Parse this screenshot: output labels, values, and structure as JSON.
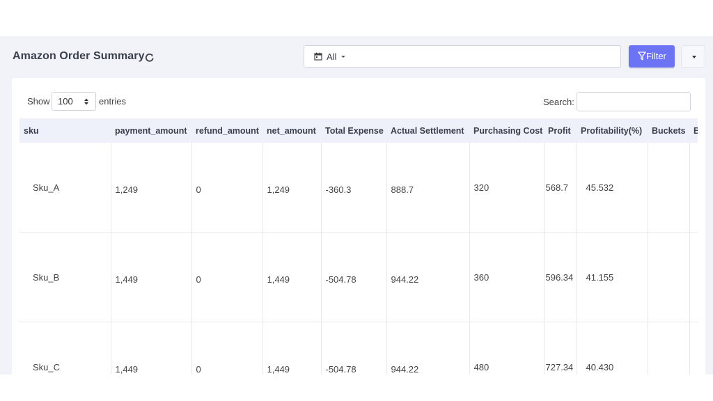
{
  "header": {
    "title": "Amazon Order Summary",
    "date_filter": "All",
    "filter_button": "Filter"
  },
  "controls": {
    "show_label": "Show",
    "page_length": "100",
    "entries_label": "entries",
    "search_label": "Search:",
    "search_value": ""
  },
  "table": {
    "columns": [
      "sku",
      "payment_amount",
      "refund_amount",
      "net_amount",
      "Total Expense",
      "Actual Settlement",
      "Purchasing Cost",
      "Profit",
      "Profitability(%)",
      "Buckets",
      "B"
    ],
    "rows": [
      {
        "sku": "Sku_A",
        "payment_amount": "1,249",
        "refund_amount": "0",
        "net_amount": "1,249",
        "total_expense": "-360.3",
        "actual_settlement": "888.7",
        "purchasing_cost": "320",
        "profit": "568.7",
        "profitability": "45.532",
        "buckets": "",
        "extra": ""
      },
      {
        "sku": "Sku_B",
        "payment_amount": "1,449",
        "refund_amount": "0",
        "net_amount": "1,449",
        "total_expense": "-504.78",
        "actual_settlement": "944.22",
        "purchasing_cost": "360",
        "profit": "596.34",
        "profitability": "41.155",
        "buckets": "",
        "extra": ""
      },
      {
        "sku": "Sku_C",
        "payment_amount": "1,449",
        "refund_amount": "0",
        "net_amount": "1,449",
        "total_expense": "-504.78",
        "actual_settlement": "944.22",
        "purchasing_cost": "480",
        "profit": "727.34",
        "profitability": "40.430",
        "buckets": "",
        "extra": ""
      }
    ]
  },
  "colors": {
    "accent": "#6c73f5",
    "panel_bg": "#f1f3f9",
    "header_bg": "#eef1f9"
  },
  "icons": {
    "refresh": "refresh-icon",
    "calendar": "calendar-icon",
    "filter": "filter-icon"
  }
}
